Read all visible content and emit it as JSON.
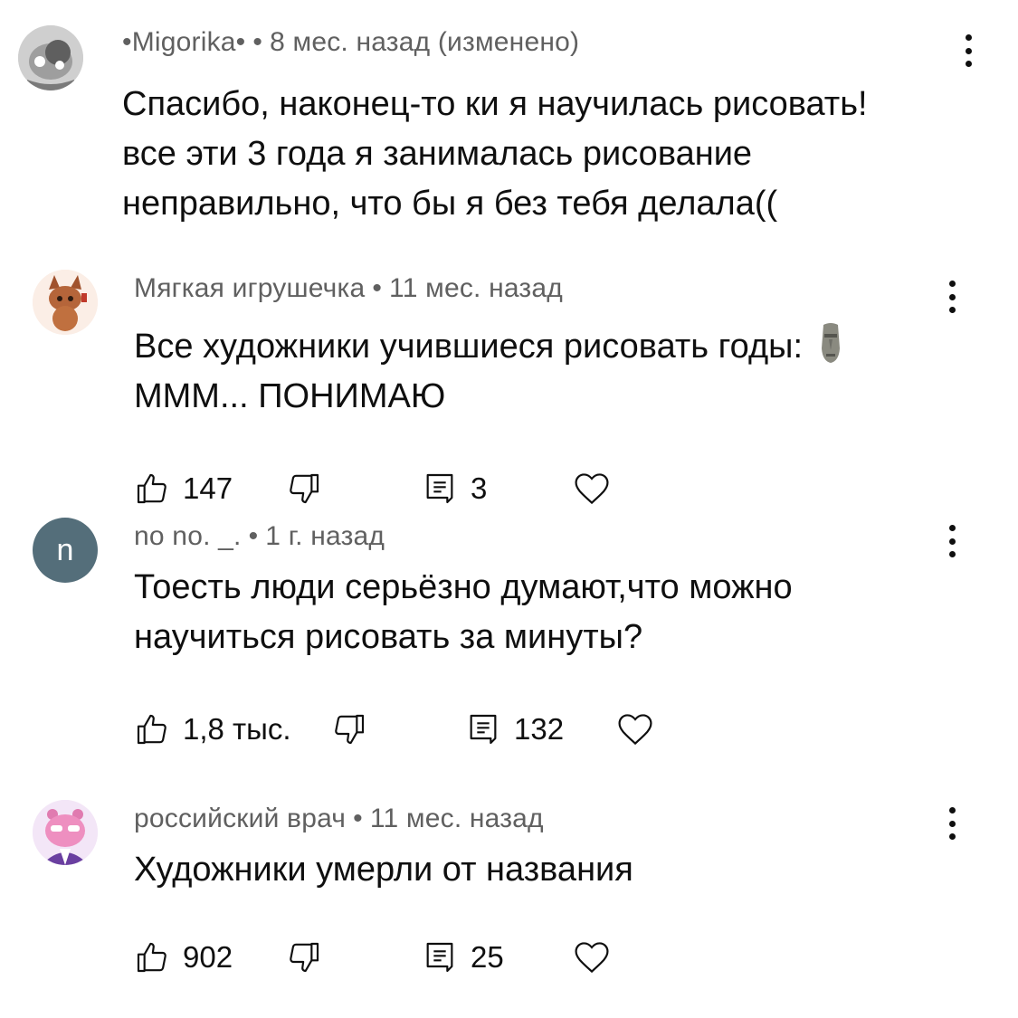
{
  "comments": [
    {
      "author": "•Migorika•",
      "time": "8 мес. назад (изменено)",
      "text": "Спасибо, наконец-то ки я научилась рисовать!\nвсе эти 3 года я занималась рисование\nнеправильно, что бы я без тебя делала((",
      "avatar": "avatar-image-grey-character"
    },
    {
      "author": "Мягкая игрушечка",
      "time": "11 мес. назад",
      "text_line1": "Все художники учившиеся рисовать годы:",
      "emoji": "moai-emoji",
      "text_line2": "МММ... ПОНИМАЮ",
      "likes": "147",
      "replies": "3",
      "avatar": "avatar-image-brown-creature"
    },
    {
      "author": "no no. _.",
      "time": "1 г. назад",
      "text": "Тоесть люди серьёзно думают,что можно\nнаучиться рисовать за минуты?",
      "likes": "1,8 тыс.",
      "replies": "132",
      "avatar_letter": "n",
      "avatar_color": "#546e7a"
    },
    {
      "author": "российский врач",
      "time": "11 мес. назад",
      "text": "Художники умерли от названия",
      "likes": "902",
      "replies": "25",
      "avatar": "avatar-image-pink-character"
    }
  ],
  "separator": "•",
  "icons": {
    "like": "thumb-up-icon",
    "dislike": "thumb-down-icon",
    "reply": "reply-icon",
    "heart": "heart-icon",
    "more": "more-vert-icon"
  }
}
